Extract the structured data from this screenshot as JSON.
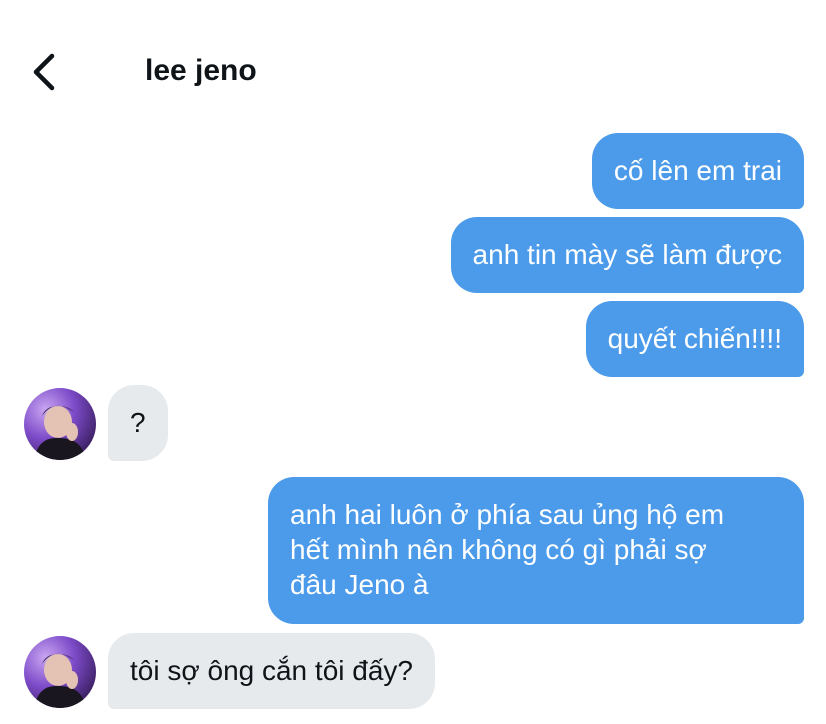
{
  "header": {
    "title": "lee jeno",
    "back_icon": "chevron-left-icon"
  },
  "messages": [
    {
      "direction": "sent",
      "text": "cố lên em trai"
    },
    {
      "direction": "sent",
      "text": "anh tin mày sẽ làm được"
    },
    {
      "direction": "sent",
      "text": "quyết chiến!!!!"
    },
    {
      "direction": "received",
      "text": "?"
    },
    {
      "direction": "sent",
      "lines": [
        "anh hai luôn ở phía sau ủng hộ em",
        "hết mình nên không có gì phải sợ",
        "đâu Jeno à"
      ]
    },
    {
      "direction": "received",
      "text": "tôi sợ ông cắn tôi đấy?"
    }
  ],
  "colors": {
    "sent_bubble": "#4c9bea",
    "received_bubble": "#e7eaed",
    "sent_text": "#ffffff",
    "received_text": "#0f1419"
  }
}
